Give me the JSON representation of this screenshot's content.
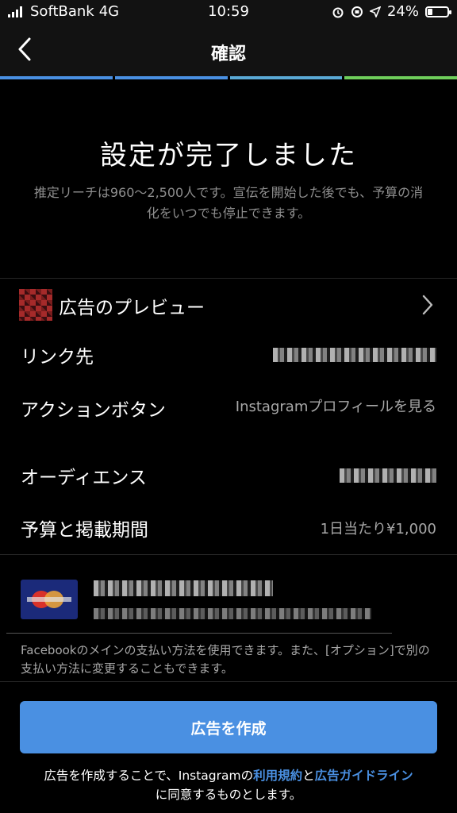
{
  "status_bar": {
    "carrier": "SoftBank",
    "network": "4G",
    "time": "10:59",
    "battery": "24%",
    "battery_level": 0.24
  },
  "nav": {
    "title": "確認",
    "back_icon": "chevron-left-icon"
  },
  "progress_colors": [
    "#4a90e2",
    "#4a90e2",
    "#5aa9d6",
    "#6fce5b"
  ],
  "hero": {
    "title": "設定が完了しました",
    "subtitle": "推定リーチは960〜2,500人です。宣伝を開始した後でも、予算の消化をいつでも停止できます。"
  },
  "rows": {
    "preview": {
      "label": "広告のプレビュー"
    },
    "link": {
      "label": "リンク先"
    },
    "action": {
      "label": "アクションボタン",
      "value": "Instagramプロフィールを見る"
    },
    "audience": {
      "label": "オーディエンス"
    },
    "budget": {
      "label": "予算と掲載期間",
      "value": "1日当たり¥1,000"
    }
  },
  "payment_note": "Facebookのメインの支払い方法を使用できます。また、[オプション]で別の支払い方法に変更することもできます。",
  "cta": {
    "label": "広告を作成",
    "color": "#4a90e2"
  },
  "terms": {
    "prefix": "広告を作成することで、Instagramの",
    "link1": "利用規約",
    "mid": "と",
    "link2": "広告ガイドライン",
    "suffix": "に同意するものとします。"
  }
}
